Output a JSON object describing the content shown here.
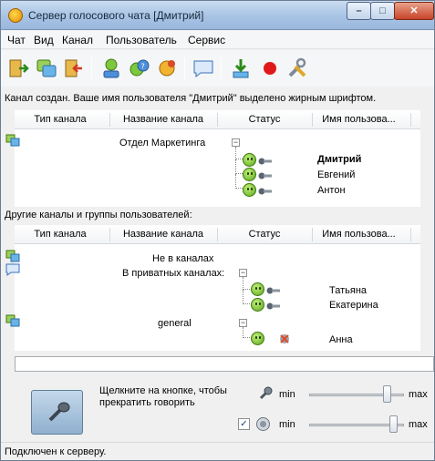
{
  "window": {
    "title": "Сервер голосового чата [Дмитрий]"
  },
  "menu": [
    "Чат",
    "Вид",
    "Канал",
    "Пользователь",
    "Сервис"
  ],
  "info_text": "Канал создан. Ваше имя пользователя \"Дмитрий\" выделено жирным шрифтом.",
  "channel_table": {
    "columns": [
      "Тип канала",
      "Название канала",
      "Статус",
      "Имя пользова..."
    ],
    "channel_name": "Отдел Маркетинга",
    "users": [
      "Дмитрий",
      "Евгений",
      "Антон"
    ]
  },
  "other_label": "Другие каналы и группы пользователей:",
  "other_table": {
    "columns": [
      "Тип канала",
      "Название канала",
      "Статус",
      "Имя пользова..."
    ],
    "not_in_channels": "Не в каналах",
    "private_label": "В приватных каналах:",
    "private_users": [
      "Татьяна",
      "Екатерина"
    ],
    "general_name": "general",
    "general_users": [
      "Анна"
    ]
  },
  "bottom": {
    "hint": "Щелкните на кнопке, чтобы прекратить говорить",
    "min_label": "min",
    "max_label": "max",
    "mic_level": 0.85,
    "speaker_level": 0.93,
    "speaker_checked": true
  },
  "status": "Подключен к серверу.",
  "colors": {
    "accent": "#2a6fbf"
  }
}
